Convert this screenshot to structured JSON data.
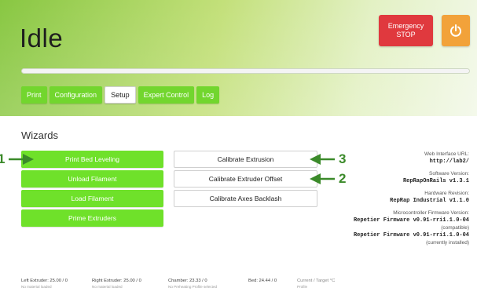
{
  "header": {
    "status": "Idle",
    "emergency_stop": {
      "line1": "Emergency",
      "line2": "STOP"
    },
    "power_icon": "power-icon",
    "colors": {
      "estop": "#e0393e",
      "power": "#f2a23a",
      "accent": "#72d62e"
    }
  },
  "tabs": [
    {
      "label": "Print"
    },
    {
      "label": "Configuration"
    },
    {
      "label": "Setup"
    },
    {
      "label": "Expert Control"
    },
    {
      "label": "Log"
    }
  ],
  "wizards": {
    "title": "Wizards",
    "left_buttons": [
      {
        "label": "Print Bed Leveling"
      },
      {
        "label": "Unload Filament"
      },
      {
        "label": "Load Filament"
      },
      {
        "label": "Prime Extruders"
      }
    ],
    "mid_buttons": [
      {
        "label": "Calibrate Extrusion"
      },
      {
        "label": "Calibrate Extruder Offset"
      },
      {
        "label": "Calibrate Axes Backlash"
      }
    ],
    "annotations": [
      "1",
      "3",
      "2"
    ]
  },
  "info": {
    "web_interface_label": "Web Interface URL:",
    "web_interface_value": "http://lab2/",
    "software_label": "Software Version:",
    "software_value": "RepRapOnRails v1.3.1",
    "hardware_label": "Hardware Revision:",
    "hardware_value": "RepRap Industrial v1.1.0",
    "firmware_label": "Microcontroller Firmware Version:",
    "firmware_value": "Repetier Firmware v0.91-rri1.1.0-04",
    "compat_label": "(compatible)",
    "firmware_value2": "Repetier Firmware v0.91-rri1.1.0-04",
    "installed_label": "(currently installed)"
  },
  "footer": {
    "left_extruder": {
      "title": "Left Extruder: 25.00 / 0",
      "sub": "No material loaded"
    },
    "right_extruder": {
      "title": "Right Extruder: 25.00 / 0",
      "sub": "No material loaded"
    },
    "chamber": {
      "title": "Chamber: 23.33 / 0",
      "sub": "No Preheating Profile selected"
    },
    "bed": {
      "title": "Bed: 24.44 / 0",
      "sub": ""
    },
    "current_target": {
      "title": "Current / Target °C",
      "sub": "Profile"
    }
  }
}
